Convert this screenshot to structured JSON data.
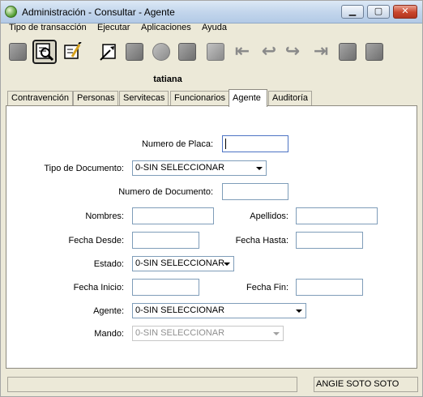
{
  "window": {
    "title": "Administración - Consultar - Agente",
    "buttons": {
      "minimize": "▁",
      "maximize": "▢",
      "close": "✕"
    }
  },
  "menu": [
    "Tipo de transacción",
    "Ejecutar",
    "Aplicaciones",
    "Ayuda"
  ],
  "toolbar": {
    "icons": [
      "add-icon",
      "query-icon",
      "edit-icon",
      "report-icon",
      "save-icon",
      "delete-icon",
      "print-icon",
      "copy-icon",
      "first-icon",
      "previous-icon",
      "next-icon",
      "last-icon",
      "attach-icon",
      "list-icon"
    ],
    "active": "query-icon"
  },
  "user": {
    "name": "tatiana"
  },
  "tabs": [
    "Contravención",
    "Personas",
    "Servitecas",
    "Funcionarios",
    "Agente",
    "Auditoría"
  ],
  "active_tab": "Agente",
  "form": {
    "numero_placa": {
      "label": "Numero de Placa:",
      "value": ""
    },
    "tipo_documento": {
      "label": "Tipo de Documento:",
      "value": "0-SIN SELECCIONAR"
    },
    "numero_documento": {
      "label": "Numero de Documento:",
      "value": ""
    },
    "nombres": {
      "label": "Nombres:",
      "value": ""
    },
    "apellidos": {
      "label": "Apellidos:",
      "value": ""
    },
    "fecha_desde": {
      "label": "Fecha Desde:",
      "value": ""
    },
    "fecha_hasta": {
      "label": "Fecha Hasta:",
      "value": ""
    },
    "estado": {
      "label": "Estado:",
      "value": "0-SIN SELECCIONAR"
    },
    "fecha_inicio": {
      "label": "Fecha Inicio:",
      "value": ""
    },
    "fecha_fin": {
      "label": "Fecha Fin:",
      "value": ""
    },
    "agente": {
      "label": "Agente:",
      "value": "0-SIN SELECCIONAR"
    },
    "mando": {
      "label": "Mando:",
      "value": "0-SIN SELECCIONAR",
      "disabled": true
    }
  },
  "status": {
    "left": "",
    "right": "ANGIE  SOTO SOTO"
  }
}
